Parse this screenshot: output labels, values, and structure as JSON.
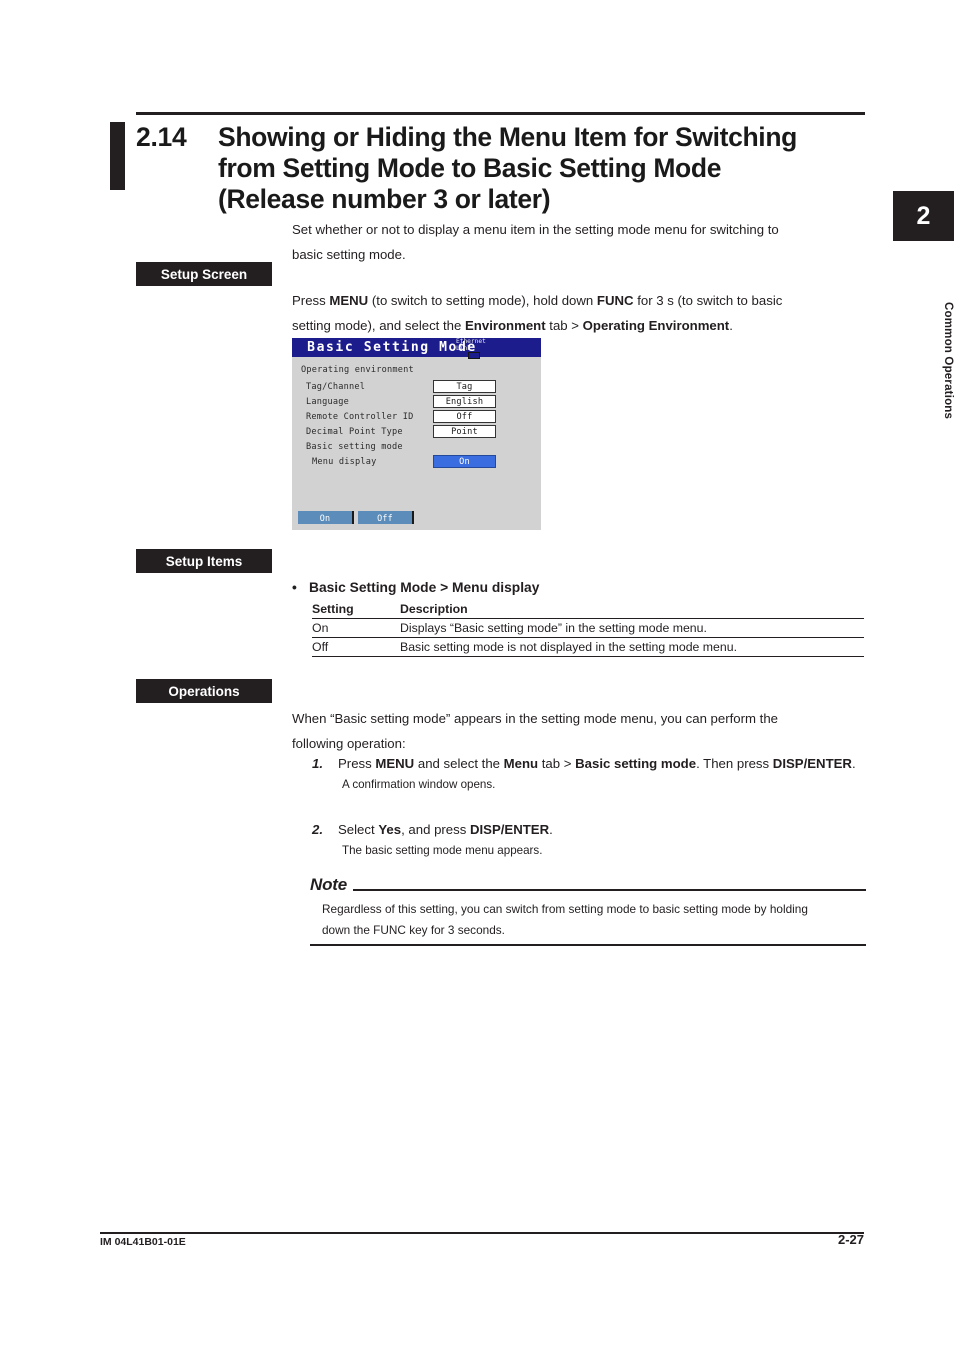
{
  "heading": {
    "number": "2.14",
    "line1": "Showing or Hiding the Menu Item for Switching",
    "line2": "from Setting Mode to Basic Setting Mode",
    "line3": "(Release number 3 or later)"
  },
  "side_tab": {
    "chapter": "2",
    "label": "Common Operations"
  },
  "intro": {
    "line1": "Set whether or not to display a menu item in the setting mode menu for switching to",
    "line2": "basic setting mode."
  },
  "sections": {
    "setup_screen": "Setup Screen",
    "setup_items": "Setup Items",
    "operations": "Operations"
  },
  "setup_screen": {
    "instruction_pre": "Press ",
    "menu_key": "MENU",
    "instruction_mid1": " (to switch to setting mode), hold down ",
    "func_key": "FUNC",
    "instruction_mid2": " for 3 s (to switch to basic",
    "instruction_line2_pre": "setting mode), and select the ",
    "environment_tab": "Environment",
    "instruction_mid3": " tab > ",
    "operating_environment": "Operating Environment",
    "instruction_end": "."
  },
  "lcd": {
    "title": "Basic Setting Mode",
    "ethernet_line1": "Ethernet",
    "ethernet_line2": "Link",
    "section_heading": "Operating environment",
    "rows": [
      {
        "label": "Tag/Channel",
        "value": "Tag",
        "indent": 1,
        "selected": false
      },
      {
        "label": "Language",
        "value": "English",
        "indent": 1,
        "selected": false
      },
      {
        "label": "Remote Controller ID",
        "value": "Off",
        "indent": 1,
        "selected": false
      },
      {
        "label": "Decimal Point Type",
        "value": "Point",
        "indent": 1,
        "selected": false
      }
    ],
    "group_label": "Basic setting mode",
    "menu_row": {
      "label": "Menu display",
      "value": "On",
      "selected": true
    },
    "softkeys": [
      "On",
      "Off"
    ],
    "colors": {
      "title_bar": "#1c1c8c",
      "background": "#d2d2d2",
      "selected_value": "#3a6ee0",
      "softkey": "#5b8cba"
    }
  },
  "setup_items": {
    "bullet": "•",
    "title": "Basic Setting Mode > Menu display",
    "table": {
      "headers": [
        "Setting",
        "Description"
      ],
      "rows": [
        [
          "On",
          "Displays “Basic setting mode” in the setting mode menu."
        ],
        [
          "Off",
          "Basic setting mode is not displayed in the setting mode menu."
        ]
      ]
    }
  },
  "operations": {
    "intro_line1": "When “Basic setting mode” appears in the setting mode menu, you can perform the",
    "intro_line2": "following operation:",
    "steps": [
      {
        "number": "1.",
        "text_pre": "Press ",
        "b1": "MENU",
        "text_mid1": " and select the ",
        "b2": "Menu",
        "text_mid2": " tab > ",
        "b3": "Basic setting mode",
        "text_mid3": ". Then press ",
        "b4": "DISP/",
        "b5": "ENTER",
        "text_end": ".",
        "sub": "A confirmation window opens."
      },
      {
        "number": "2.",
        "text_pre": "Select ",
        "b1": "Yes",
        "text_mid1": ", and press ",
        "b2": "DISP/ENTER",
        "text_end": ".",
        "sub": "The basic setting mode menu appears."
      }
    ]
  },
  "note": {
    "title": "Note",
    "line1": "Regardless of this setting, you can switch from setting mode to basic setting mode by holding",
    "line2": "down the FUNC key for 3 seconds."
  },
  "footer": {
    "document_id": "IM 04L41B01-01E",
    "page_number": "2-27"
  }
}
